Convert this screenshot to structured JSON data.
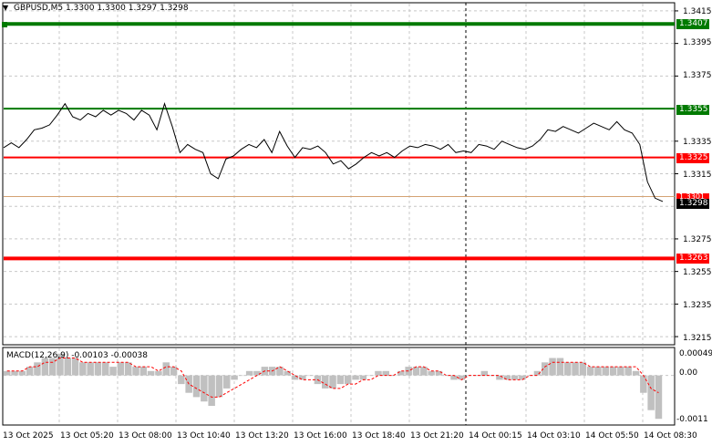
{
  "header": {
    "arrow": "▼",
    "text": "GBPUSD,M5  1.3300 1.3300 1.3297 1.3298"
  },
  "macd_panel": {
    "label": "MACD(12,26,9) -0.00103 -0.00038",
    "axis": [
      "0.00049",
      "0.00",
      "-0.0011"
    ]
  },
  "price_axis": [
    "1.3415",
    "1.3395",
    "1.3375",
    "1.3335",
    "1.3315",
    "1.3275",
    "1.3255",
    "1.3235",
    "1.3215"
  ],
  "levels": {
    "green_top": "1.3407",
    "green_mid": "1.3355",
    "red_mid": "1.3325",
    "orange": "1.3301",
    "current": "1.3298",
    "red_bottom": "1.3263"
  },
  "time_axis": [
    "13 Oct 2025",
    "13 Oct 05:20",
    "13 Oct 08:00",
    "13 Oct 10:40",
    "13 Oct 13:20",
    "13 Oct 16:00",
    "13 Oct 18:40",
    "13 Oct 21:20",
    "14 Oct 00:15",
    "14 Oct 03:10",
    "14 Oct 05:50",
    "14 Oct 08:30"
  ],
  "colors": {
    "green": "#007a00",
    "red": "#ff0000",
    "orange": "#d4a373",
    "price_line": "#000000",
    "histogram": "#c0c0c0",
    "signal": "#ff0000",
    "grid": "#c8c8c8"
  },
  "chart_data": {
    "type": "line",
    "series": [
      {
        "values": [
          1.3331,
          1.3334,
          1.3331,
          1.3336,
          1.3342,
          1.3343,
          1.3345,
          1.3351,
          1.3358,
          1.335,
          1.3348,
          1.3352,
          1.335,
          1.3354,
          1.3351,
          1.3354,
          1.3352,
          1.3348,
          1.3354,
          1.3351,
          1.3342,
          1.3358,
          1.3344,
          1.3328,
          1.3333,
          1.333,
          1.3328,
          1.3315,
          1.3312,
          1.3324,
          1.3326,
          1.333,
          1.3333,
          1.3331,
          1.3336,
          1.3328,
          1.3341,
          1.3332,
          1.3325,
          1.3331,
          1.333,
          1.3332,
          1.3328,
          1.3321,
          1.3323,
          1.3318,
          1.3321,
          1.3325,
          1.3328,
          1.3326,
          1.3328,
          1.3325,
          1.3329,
          1.3332,
          1.3331,
          1.3333,
          1.3332,
          1.333,
          1.3333,
          1.3328,
          1.3329,
          1.3328,
          1.3333,
          1.3332,
          1.333,
          1.3335,
          1.3333,
          1.3331,
          1.333,
          1.3332,
          1.3336,
          1.3342,
          1.3341,
          1.3344,
          1.3342,
          1.334,
          1.3343,
          1.3346,
          1.3344,
          1.3342,
          1.3347,
          1.3342,
          1.334,
          1.3333,
          1.331,
          1.33,
          1.3298
        ]
      }
    ],
    "ylim": [
      1.321,
      1.342
    ],
    "macd": {
      "histogram": [
        0.0001,
        0.0001,
        0.0001,
        0.0002,
        0.0003,
        0.0004,
        0.0004,
        0.0005,
        0.0004,
        0.0004,
        0.0003,
        0.0003,
        0.0003,
        0.0003,
        0.0002,
        0.0003,
        0.0003,
        0.0002,
        0.0002,
        0.0001,
        0.0001,
        0.0003,
        0.0002,
        -0.0002,
        -0.0004,
        -0.0005,
        -0.0006,
        -0.0007,
        -0.0005,
        -0.0003,
        -0.0001,
        0.0,
        0.0001,
        0.0001,
        0.0002,
        0.0002,
        0.0002,
        0.0001,
        -0.0001,
        -0.0001,
        0.0,
        -0.0002,
        -0.0003,
        -0.0003,
        -0.0002,
        -0.0002,
        -0.0001,
        -0.0001,
        0.0,
        0.0001,
        0.0001,
        0.0,
        0.0001,
        0.0002,
        0.0002,
        0.0002,
        0.0001,
        0.0001,
        0.0,
        -0.0001,
        -0.0001,
        0.0,
        0.0,
        0.0001,
        0.0,
        -0.0001,
        -0.0001,
        -0.0001,
        -0.0001,
        0.0,
        0.0001,
        0.0003,
        0.0004,
        0.0004,
        0.0003,
        0.0003,
        0.0003,
        0.0002,
        0.0002,
        0.0002,
        0.0002,
        0.0002,
        0.0002,
        0.0001,
        -0.0004,
        -0.0008,
        -0.001
      ],
      "signal": [
        0.0001,
        0.0001,
        0.0001,
        0.0002,
        0.0002,
        0.0003,
        0.0003,
        0.0004,
        0.0004,
        0.0004,
        0.0003,
        0.0003,
        0.0003,
        0.0003,
        0.0003,
        0.0003,
        0.0003,
        0.0002,
        0.0002,
        0.0002,
        0.0001,
        0.0002,
        0.0002,
        0.0001,
        -0.0002,
        -0.0003,
        -0.0004,
        -0.0005,
        -0.0005,
        -0.0004,
        -0.0003,
        -0.0002,
        -0.0001,
        0.0,
        0.0001,
        0.0001,
        0.0002,
        0.0001,
        0.0,
        -0.0001,
        -0.0001,
        -0.0001,
        -0.0002,
        -0.0003,
        -0.0003,
        -0.0002,
        -0.0002,
        -0.0001,
        -0.0001,
        0.0,
        0.0,
        0.0,
        0.0001,
        0.0001,
        0.0002,
        0.0002,
        0.0001,
        0.0001,
        0.0,
        0.0,
        -0.0001,
        0.0,
        0.0,
        0.0,
        0.0,
        0.0,
        -0.0001,
        -0.0001,
        -0.0001,
        0.0,
        0.0,
        0.0002,
        0.0003,
        0.0003,
        0.0003,
        0.0003,
        0.0003,
        0.0002,
        0.0002,
        0.0002,
        0.0002,
        0.0002,
        0.0002,
        0.0002,
        0.0,
        -0.0003,
        -0.0004
      ],
      "ylim": [
        -0.0011,
        0.0006
      ]
    }
  }
}
